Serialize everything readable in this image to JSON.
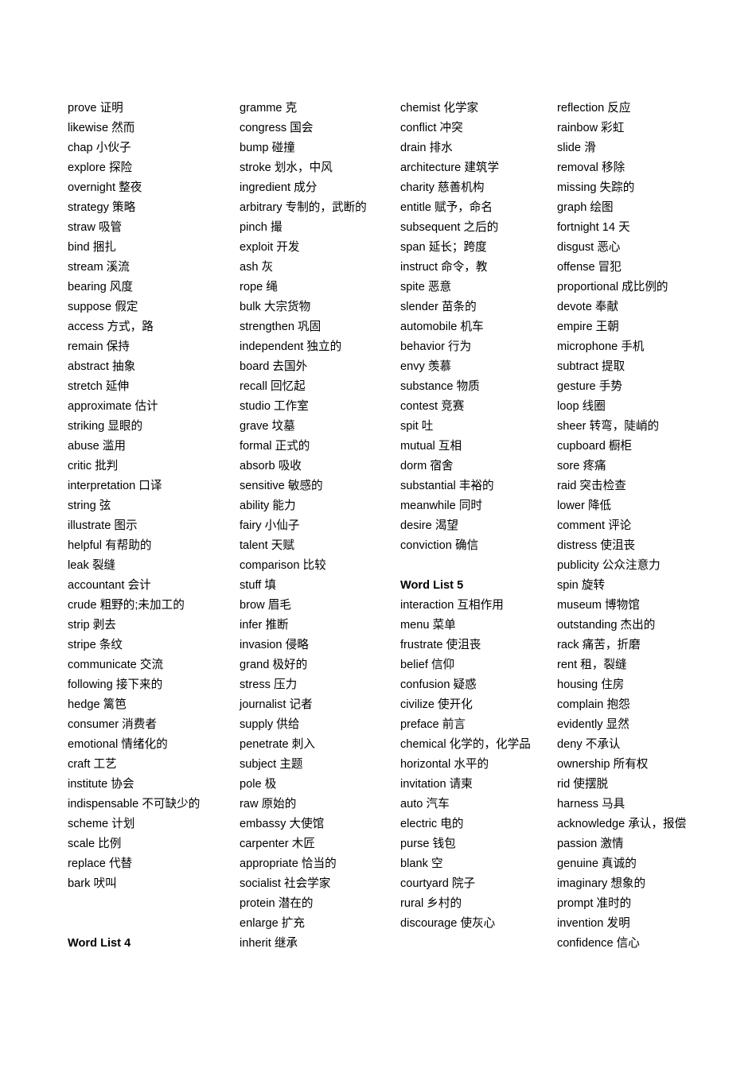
{
  "document": {
    "title": "Vocabulary Word Lists",
    "page_background": "#ffffff",
    "text_color": "#000000"
  },
  "columns": [
    {
      "id": "column-1",
      "blocks": [
        {
          "type": "entry",
          "term": "prove",
          "gloss": "证明"
        },
        {
          "type": "entry",
          "term": "likewise",
          "gloss": "然而"
        },
        {
          "type": "entry",
          "term": "chap",
          "gloss": "小伙子"
        },
        {
          "type": "entry",
          "term": "explore",
          "gloss": "探险"
        },
        {
          "type": "entry",
          "term": "overnight",
          "gloss": "整夜"
        },
        {
          "type": "entry",
          "term": "strategy",
          "gloss": "策略"
        },
        {
          "type": "entry",
          "term": "straw",
          "gloss": "吸管"
        },
        {
          "type": "entry",
          "term": "bind",
          "gloss": "捆扎"
        },
        {
          "type": "entry",
          "term": "stream",
          "gloss": "溪流"
        },
        {
          "type": "entry",
          "term": "bearing",
          "gloss": "风度"
        },
        {
          "type": "entry",
          "term": "suppose",
          "gloss": "假定"
        },
        {
          "type": "entry",
          "term": "access",
          "gloss": "方式，路"
        },
        {
          "type": "entry",
          "term": "remain",
          "gloss": "保持"
        },
        {
          "type": "entry",
          "term": "abstract",
          "gloss": "抽象"
        },
        {
          "type": "entry",
          "term": "stretch",
          "gloss": "延伸"
        },
        {
          "type": "entry",
          "term": "approximate",
          "gloss": "估计"
        },
        {
          "type": "entry",
          "term": "striking",
          "gloss": "显眼的"
        },
        {
          "type": "entry",
          "term": "abuse",
          "gloss": "滥用"
        },
        {
          "type": "entry",
          "term": "critic",
          "gloss": "批判"
        },
        {
          "type": "entry",
          "term": "interpretation",
          "gloss": "口译"
        },
        {
          "type": "entry",
          "term": "string",
          "gloss": "弦"
        },
        {
          "type": "entry",
          "term": "illustrate",
          "gloss": "图示"
        },
        {
          "type": "entry",
          "term": "helpful",
          "gloss": "有帮助的"
        },
        {
          "type": "entry",
          "term": "leak",
          "gloss": "裂缝"
        },
        {
          "type": "entry",
          "term": "accountant",
          "gloss": "会计"
        },
        {
          "type": "entry",
          "term": "crude",
          "gloss": "粗野的;未加工的"
        },
        {
          "type": "entry",
          "term": "strip",
          "gloss": "剥去"
        },
        {
          "type": "entry",
          "term": "stripe",
          "gloss": "条纹"
        },
        {
          "type": "entry",
          "term": "communicate",
          "gloss": "交流"
        },
        {
          "type": "entry",
          "term": "following",
          "gloss": "接下来的"
        },
        {
          "type": "entry",
          "term": "hedge",
          "gloss": "篱笆"
        },
        {
          "type": "entry",
          "term": "consumer",
          "gloss": "消费者"
        },
        {
          "type": "entry",
          "term": "emotional",
          "gloss": "情绪化的"
        },
        {
          "type": "entry",
          "term": "craft",
          "gloss": "工艺"
        },
        {
          "type": "entry",
          "term": "institute",
          "gloss": "协会"
        },
        {
          "type": "entry",
          "term": "indispensable",
          "gloss": "不可缺少的"
        },
        {
          "type": "entry",
          "term": "scheme",
          "gloss": "计划"
        },
        {
          "type": "entry",
          "term": "scale",
          "gloss": "比例"
        },
        {
          "type": "entry",
          "term": "replace",
          "gloss": "代替"
        },
        {
          "type": "entry",
          "term": "bark",
          "gloss": "吠叫"
        },
        {
          "type": "spacer"
        },
        {
          "type": "spacer"
        },
        {
          "type": "heading",
          "text": "Word List 4"
        }
      ]
    },
    {
      "id": "column-2",
      "blocks": [
        {
          "type": "entry",
          "term": "gramme",
          "gloss": "克"
        },
        {
          "type": "entry",
          "term": "congress",
          "gloss": "国会"
        },
        {
          "type": "entry",
          "term": "bump",
          "gloss": "碰撞"
        },
        {
          "type": "entry",
          "term": "stroke",
          "gloss": "划水，中风"
        },
        {
          "type": "entry",
          "term": "ingredient",
          "gloss": "成分"
        },
        {
          "type": "entry",
          "term": "arbitrary",
          "gloss": "专制的，武断的"
        },
        {
          "type": "entry",
          "term": "pinch",
          "gloss": "撮"
        },
        {
          "type": "entry",
          "term": "exploit",
          "gloss": "开发"
        },
        {
          "type": "entry",
          "term": "ash",
          "gloss": "灰"
        },
        {
          "type": "entry",
          "term": "rope",
          "gloss": "绳"
        },
        {
          "type": "entry",
          "term": "bulk",
          "gloss": "大宗货物"
        },
        {
          "type": "entry",
          "term": "strengthen",
          "gloss": "巩固"
        },
        {
          "type": "entry",
          "term": "independent",
          "gloss": "独立的"
        },
        {
          "type": "entry",
          "term": "board",
          "gloss": "去国外"
        },
        {
          "type": "entry",
          "term": "recall",
          "gloss": "回忆起"
        },
        {
          "type": "entry",
          "term": "studio",
          "gloss": "工作室"
        },
        {
          "type": "entry",
          "term": "grave",
          "gloss": "坟墓"
        },
        {
          "type": "entry",
          "term": "formal",
          "gloss": "正式的"
        },
        {
          "type": "entry",
          "term": "absorb",
          "gloss": "吸收"
        },
        {
          "type": "entry",
          "term": "sensitive",
          "gloss": "敏感的"
        },
        {
          "type": "entry",
          "term": "ability",
          "gloss": "能力"
        },
        {
          "type": "entry",
          "term": "fairy",
          "gloss": "小仙子"
        },
        {
          "type": "entry",
          "term": "talent",
          "gloss": "天赋"
        },
        {
          "type": "entry",
          "term": "comparison",
          "gloss": "比较"
        },
        {
          "type": "entry",
          "term": "stuff",
          "gloss": "填"
        },
        {
          "type": "entry",
          "term": "brow",
          "gloss": "眉毛"
        },
        {
          "type": "entry",
          "term": "infer",
          "gloss": "推断"
        },
        {
          "type": "entry",
          "term": "invasion",
          "gloss": "侵略"
        },
        {
          "type": "entry",
          "term": "grand",
          "gloss": "极好的"
        },
        {
          "type": "entry",
          "term": "stress",
          "gloss": "压力"
        },
        {
          "type": "entry",
          "term": "journalist",
          "gloss": "记者"
        },
        {
          "type": "entry",
          "term": "supply",
          "gloss": "供给"
        },
        {
          "type": "entry",
          "term": "penetrate",
          "gloss": "刺入"
        },
        {
          "type": "entry",
          "term": "subject",
          "gloss": "主题"
        },
        {
          "type": "entry",
          "term": "pole",
          "gloss": "极"
        },
        {
          "type": "entry",
          "term": "raw",
          "gloss": "原始的"
        },
        {
          "type": "entry",
          "term": "embassy",
          "gloss": "大使馆"
        },
        {
          "type": "entry",
          "term": "carpenter",
          "gloss": "木匠"
        },
        {
          "type": "entry",
          "term": "appropriate",
          "gloss": "恰当的"
        },
        {
          "type": "entry",
          "term": "socialist",
          "gloss": "社会学家"
        },
        {
          "type": "entry",
          "term": "protein",
          "gloss": "潜在的"
        },
        {
          "type": "entry",
          "term": "enlarge",
          "gloss": "扩充"
        },
        {
          "type": "entry",
          "term": "inherit",
          "gloss": "继承"
        }
      ]
    },
    {
      "id": "column-3",
      "blocks": [
        {
          "type": "entry",
          "term": "chemist",
          "gloss": "化学家"
        },
        {
          "type": "entry",
          "term": "conflict",
          "gloss": "冲突"
        },
        {
          "type": "entry",
          "term": "drain",
          "gloss": "排水"
        },
        {
          "type": "entry",
          "term": "architecture",
          "gloss": "建筑学"
        },
        {
          "type": "entry",
          "term": "charity",
          "gloss": "慈善机构"
        },
        {
          "type": "entry",
          "term": "entitle",
          "gloss": "赋予，命名"
        },
        {
          "type": "entry",
          "term": "subsequent",
          "gloss": "之后的"
        },
        {
          "type": "entry",
          "term": "span",
          "gloss": "延长；跨度"
        },
        {
          "type": "entry",
          "term": "instruct",
          "gloss": "命令，教"
        },
        {
          "type": "entry",
          "term": "spite",
          "gloss": "恶意"
        },
        {
          "type": "entry",
          "term": "slender",
          "gloss": "苗条的"
        },
        {
          "type": "entry",
          "term": "automobile",
          "gloss": "机车"
        },
        {
          "type": "entry",
          "term": "behavior",
          "gloss": "行为"
        },
        {
          "type": "entry",
          "term": "envy",
          "gloss": "羡慕"
        },
        {
          "type": "entry",
          "term": "substance",
          "gloss": "物质"
        },
        {
          "type": "entry",
          "term": "contest",
          "gloss": "竞赛"
        },
        {
          "type": "entry",
          "term": "spit",
          "gloss": "吐"
        },
        {
          "type": "entry",
          "term": "mutual",
          "gloss": "互相"
        },
        {
          "type": "entry",
          "term": "dorm",
          "gloss": "宿舍"
        },
        {
          "type": "entry",
          "term": "substantial",
          "gloss": "丰裕的"
        },
        {
          "type": "entry",
          "term": "meanwhile",
          "gloss": "同时"
        },
        {
          "type": "entry",
          "term": "desire",
          "gloss": "渴望"
        },
        {
          "type": "entry",
          "term": "conviction",
          "gloss": "确信"
        },
        {
          "type": "spacer"
        },
        {
          "type": "heading",
          "text": "Word List 5"
        },
        {
          "type": "entry",
          "term": "interaction",
          "gloss": "互相作用"
        },
        {
          "type": "entry",
          "term": "menu",
          "gloss": "菜单"
        },
        {
          "type": "entry",
          "term": "frustrate",
          "gloss": "使沮丧"
        },
        {
          "type": "entry",
          "term": "belief",
          "gloss": "信仰"
        },
        {
          "type": "entry",
          "term": "confusion",
          "gloss": "疑惑"
        },
        {
          "type": "entry",
          "term": "civilize",
          "gloss": "使开化"
        },
        {
          "type": "entry",
          "term": "preface",
          "gloss": "前言"
        },
        {
          "type": "entry",
          "term": "chemical",
          "gloss": "化学的，化学品"
        },
        {
          "type": "entry",
          "term": "horizontal",
          "gloss": "水平的"
        },
        {
          "type": "entry",
          "term": "invitation",
          "gloss": "请柬"
        },
        {
          "type": "entry",
          "term": "auto",
          "gloss": "汽车"
        },
        {
          "type": "entry",
          "term": "electric",
          "gloss": "电的"
        },
        {
          "type": "entry",
          "term": "purse",
          "gloss": "钱包"
        },
        {
          "type": "entry",
          "term": "blank",
          "gloss": "空"
        },
        {
          "type": "entry",
          "term": "courtyard",
          "gloss": "院子"
        },
        {
          "type": "entry",
          "term": "rural",
          "gloss": "乡村的"
        },
        {
          "type": "entry",
          "term": "discourage",
          "gloss": "使灰心"
        }
      ]
    },
    {
      "id": "column-4",
      "blocks": [
        {
          "type": "entry",
          "term": "reflection",
          "gloss": "反应"
        },
        {
          "type": "entry",
          "term": "rainbow",
          "gloss": "彩虹"
        },
        {
          "type": "entry",
          "term": "slide",
          "gloss": "滑"
        },
        {
          "type": "entry",
          "term": "removal",
          "gloss": "移除"
        },
        {
          "type": "entry",
          "term": "missing",
          "gloss": "失踪的"
        },
        {
          "type": "entry",
          "term": "graph",
          "gloss": "绘图"
        },
        {
          "type": "entry",
          "term": "fortnight",
          "gloss": "14 天"
        },
        {
          "type": "entry",
          "term": "disgust",
          "gloss": "恶心"
        },
        {
          "type": "entry",
          "term": "offense",
          "gloss": "冒犯"
        },
        {
          "type": "entry",
          "term": "proportional",
          "gloss": "成比例的"
        },
        {
          "type": "entry",
          "term": "devote",
          "gloss": "奉献"
        },
        {
          "type": "entry",
          "term": "empire",
          "gloss": "王朝"
        },
        {
          "type": "entry",
          "term": "microphone",
          "gloss": "手机"
        },
        {
          "type": "entry",
          "term": "subtract",
          "gloss": "提取"
        },
        {
          "type": "entry",
          "term": "gesture",
          "gloss": "手势"
        },
        {
          "type": "entry",
          "term": "loop",
          "gloss": "线圈"
        },
        {
          "type": "entry",
          "term": "sheer",
          "gloss": "转弯，陡峭的"
        },
        {
          "type": "entry",
          "term": "cupboard",
          "gloss": "橱柜"
        },
        {
          "type": "entry",
          "term": "sore",
          "gloss": "疼痛"
        },
        {
          "type": "entry",
          "term": "raid",
          "gloss": "突击检查"
        },
        {
          "type": "entry",
          "term": "lower",
          "gloss": "降低"
        },
        {
          "type": "entry",
          "term": "comment",
          "gloss": "评论"
        },
        {
          "type": "entry",
          "term": "distress",
          "gloss": "使沮丧"
        },
        {
          "type": "entry",
          "term": "publicity",
          "gloss": "公众注意力"
        },
        {
          "type": "entry",
          "term": "spin",
          "gloss": "旋转"
        },
        {
          "type": "entry",
          "term": "museum",
          "gloss": "博物馆"
        },
        {
          "type": "entry",
          "term": "outstanding",
          "gloss": "杰出的"
        },
        {
          "type": "entry",
          "term": "rack",
          "gloss": "痛苦，折磨"
        },
        {
          "type": "entry",
          "term": "rent",
          "gloss": "租，裂缝"
        },
        {
          "type": "entry",
          "term": "housing",
          "gloss": "住房"
        },
        {
          "type": "entry",
          "term": "complain",
          "gloss": "抱怨"
        },
        {
          "type": "entry",
          "term": "evidently",
          "gloss": "显然"
        },
        {
          "type": "entry",
          "term": "deny",
          "gloss": "不承认"
        },
        {
          "type": "entry",
          "term": "ownership",
          "gloss": "所有权"
        },
        {
          "type": "entry",
          "term": "rid",
          "gloss": "使摆脱"
        },
        {
          "type": "entry",
          "term": "harness",
          "gloss": "马具"
        },
        {
          "type": "entry",
          "term": "acknowledge",
          "gloss": "承认，报偿"
        },
        {
          "type": "entry",
          "term": "passion",
          "gloss": "激情"
        },
        {
          "type": "entry",
          "term": "genuine",
          "gloss": "真诚的"
        },
        {
          "type": "entry",
          "term": "imaginary",
          "gloss": "想象的"
        },
        {
          "type": "entry",
          "term": "prompt",
          "gloss": "准时的"
        },
        {
          "type": "entry",
          "term": "invention",
          "gloss": "发明"
        },
        {
          "type": "entry",
          "term": "confidence",
          "gloss": "信心"
        }
      ]
    }
  ]
}
